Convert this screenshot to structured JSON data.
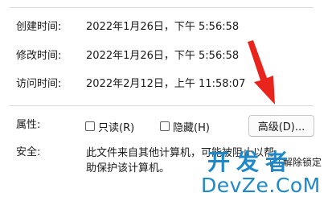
{
  "details": {
    "created_label": "创建时间:",
    "created_value": "2022年1月26日，下午 5:56:58",
    "modified_label": "修改时间:",
    "modified_value": "2022年1月26日，下午 5:56:58",
    "accessed_label": "访问时间:",
    "accessed_value": "2022年2月12日，上午 11:58:07"
  },
  "attributes": {
    "label": "属性:",
    "readonly_label": "只读(R)",
    "readonly_checked": false,
    "hidden_label": "隐藏(H)",
    "hidden_checked": false,
    "advanced_button": "高级(D)..."
  },
  "security": {
    "label": "安全:",
    "text": "此文件来自其他计算机，可能被阻止以帮助保护该计算机。",
    "unlock_label": "解除锁定",
    "unlock_checked": false
  },
  "watermark": {
    "cn": "开发者",
    "en": "DevZe.CoM"
  },
  "colors": {
    "arrow": "#e8241c",
    "watermark": "#1e88c8"
  }
}
